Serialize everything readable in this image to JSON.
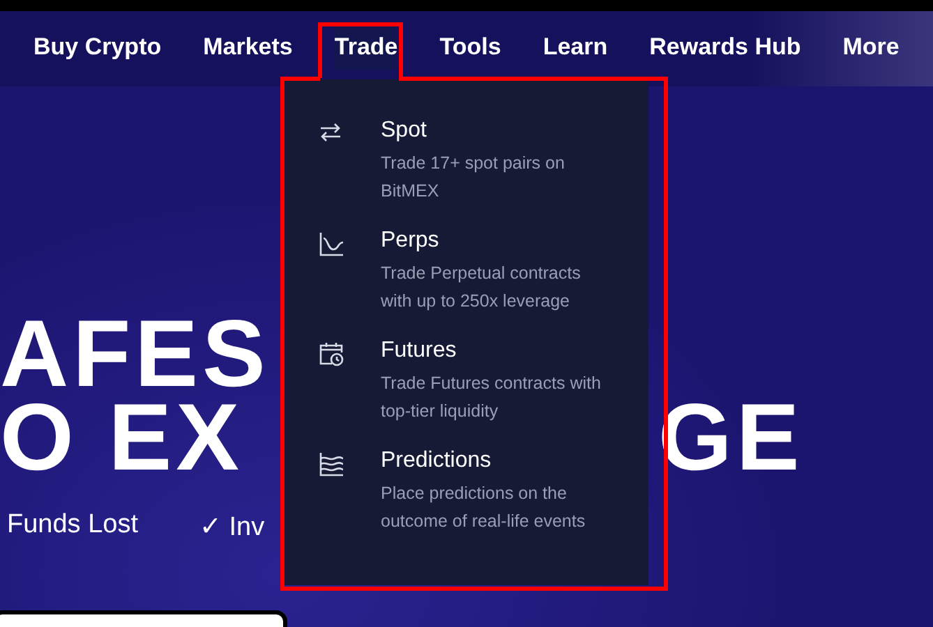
{
  "nav": {
    "items": [
      {
        "label": "Buy Crypto",
        "selected": false
      },
      {
        "label": "Markets",
        "selected": false
      },
      {
        "label": "Trade",
        "selected": true
      },
      {
        "label": "Tools",
        "selected": false
      },
      {
        "label": "Learn",
        "selected": false
      },
      {
        "label": "Rewards Hub",
        "selected": false
      },
      {
        "label": "More",
        "selected": false
      }
    ]
  },
  "trade_menu": {
    "items": [
      {
        "kind": "swap",
        "title": "Spot",
        "description": "Trade 17+ spot pairs on BitMEX"
      },
      {
        "kind": "chart",
        "title": "Perps",
        "description": "Trade Perpetual contracts with up to 250x leverage"
      },
      {
        "kind": "calendar",
        "title": "Futures",
        "description": "Trade Futures contracts with top-tier liquidity"
      },
      {
        "kind": "waves",
        "title": "Predictions",
        "description": "Place predictions on the outcome of real-life events"
      }
    ]
  },
  "hero": {
    "headline_line_1": "AFES",
    "headline_line_2": [
      "O EX",
      "GE"
    ],
    "features": [
      "Funds Lost",
      "✓ Inv"
    ]
  }
}
